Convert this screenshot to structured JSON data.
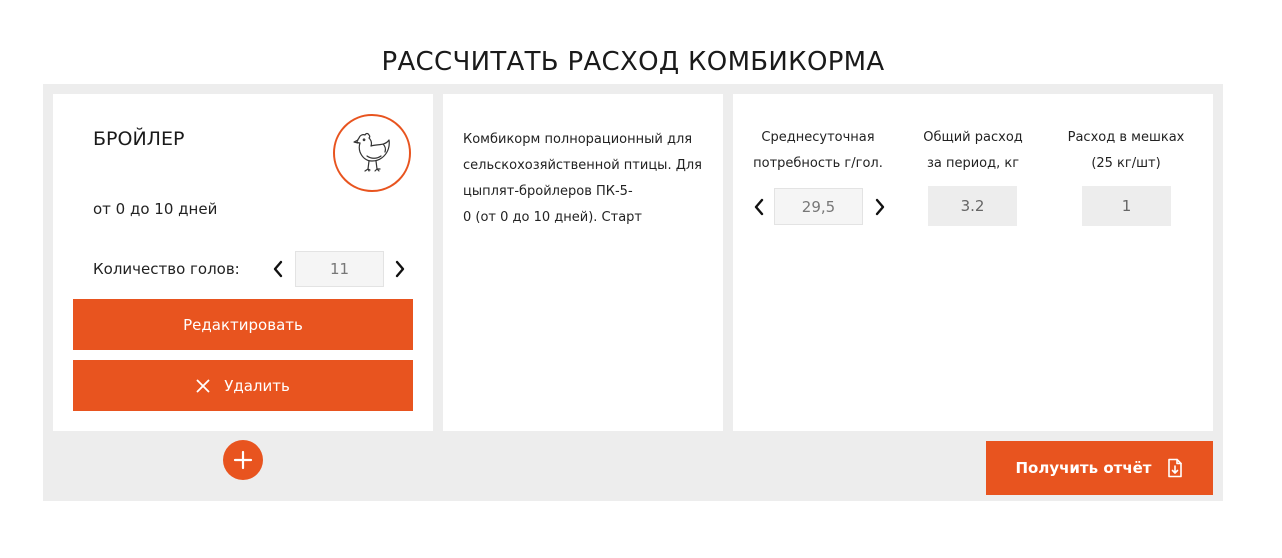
{
  "page": {
    "title": "РАССЧИТАТЬ РАСХОД КОМБИКОРМА"
  },
  "bird": {
    "name": "БРОЙЛЕР",
    "icon": "chicken-icon",
    "age": "от 0 до 10 дней",
    "count_label": "Количество голов:",
    "count_value": "11",
    "edit_label": "Редактировать",
    "delete_label": "Удалить"
  },
  "description": {
    "line1": "Комбикорм полнорационный для",
    "line2": "сельскохозяйственной птицы. Для",
    "line3": "цыплят-бройлеров ПК-5-",
    "line4": "0 (от 0 до 10 дней). Старт"
  },
  "calc": {
    "need_label_line1": "Среднесуточная",
    "need_label_line2": "потребность г/гол.",
    "need_value": "29,5",
    "total_label_line1": "Общий расход",
    "total_label_line2": "за период, кг",
    "total_value": "3.2",
    "bags_label_line1": "Расход в мешках",
    "bags_label_line2": "(25 кг/шт)",
    "bags_value": "1"
  },
  "actions": {
    "add_icon": "plus-icon",
    "report_label": "Получить отчёт",
    "report_icon": "document-download-icon"
  },
  "colors": {
    "accent": "#e8541f",
    "panel_bg": "#ededed",
    "card_bg": "#ffffff"
  }
}
